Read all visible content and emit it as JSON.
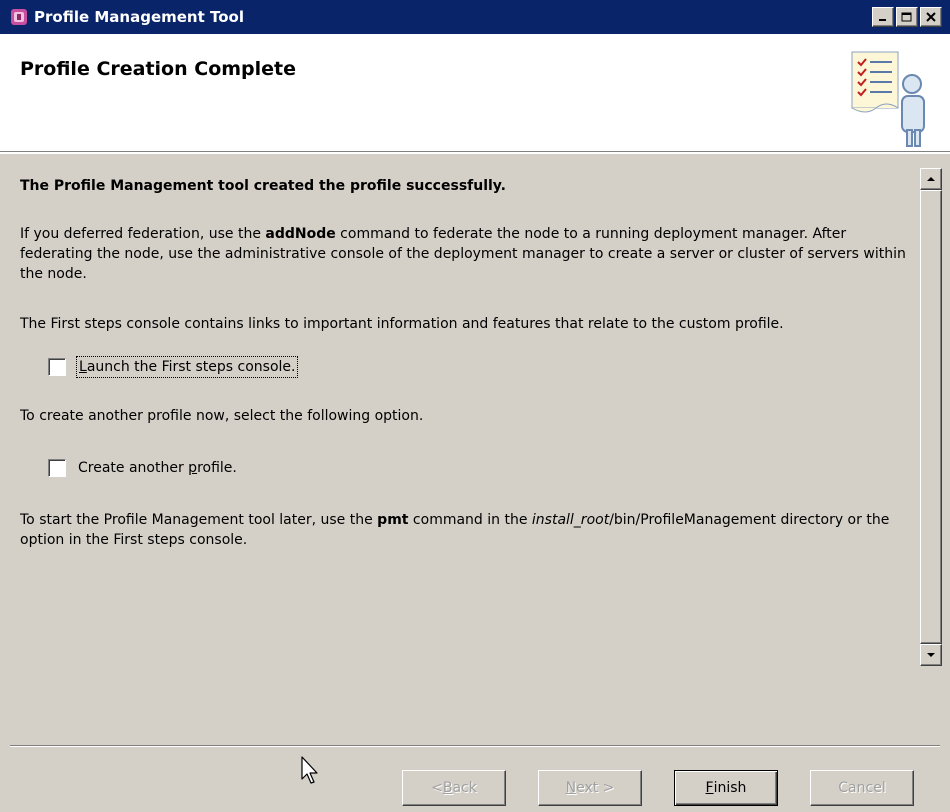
{
  "window": {
    "title": "Profile Management Tool",
    "icon": "profile-tool-app-icon"
  },
  "header": {
    "title": "Profile Creation Complete",
    "graphic": "checklist-person-icon"
  },
  "content": {
    "success_message": "The Profile Management tool created the profile successfully.",
    "deferred_pre": "If you deferred federation, use the ",
    "deferred_cmd": "addNode",
    "deferred_post": " command to federate the node to a running deployment manager. After federating the node, use the administrative console of the deployment manager to create a server or cluster of servers within the node.",
    "first_steps_info": "The First steps console contains links to important information and features that relate to the custom profile.",
    "launch_checkbox": {
      "label_ul": "L",
      "label_rest": "aunch the First steps console.",
      "checked": false
    },
    "another_profile_info": "To create another profile now, select the following option.",
    "another_checkbox": {
      "label_pre": "Create another ",
      "label_ul": "p",
      "label_post": "rofile.",
      "checked": false
    },
    "pmt_pre": "To start the Profile Management tool later, use the ",
    "pmt_cmd": "pmt",
    "pmt_mid": " command in the ",
    "pmt_path_it": "install_root",
    "pmt_path_rest": "/bin/ProfileManagement directory or the option in the First steps console."
  },
  "buttons": {
    "back": {
      "ul": "B",
      "pre": "< ",
      "post": "ack"
    },
    "next": {
      "ul": "N",
      "pre": "",
      "post": "ext >"
    },
    "finish": {
      "ul": "F",
      "pre": "",
      "post": "inish"
    },
    "cancel": "Cancel"
  },
  "colors": {
    "titlebar": "#0a246a",
    "dialog_bg": "#d4d0c8",
    "header_bg": "#ffffff"
  }
}
